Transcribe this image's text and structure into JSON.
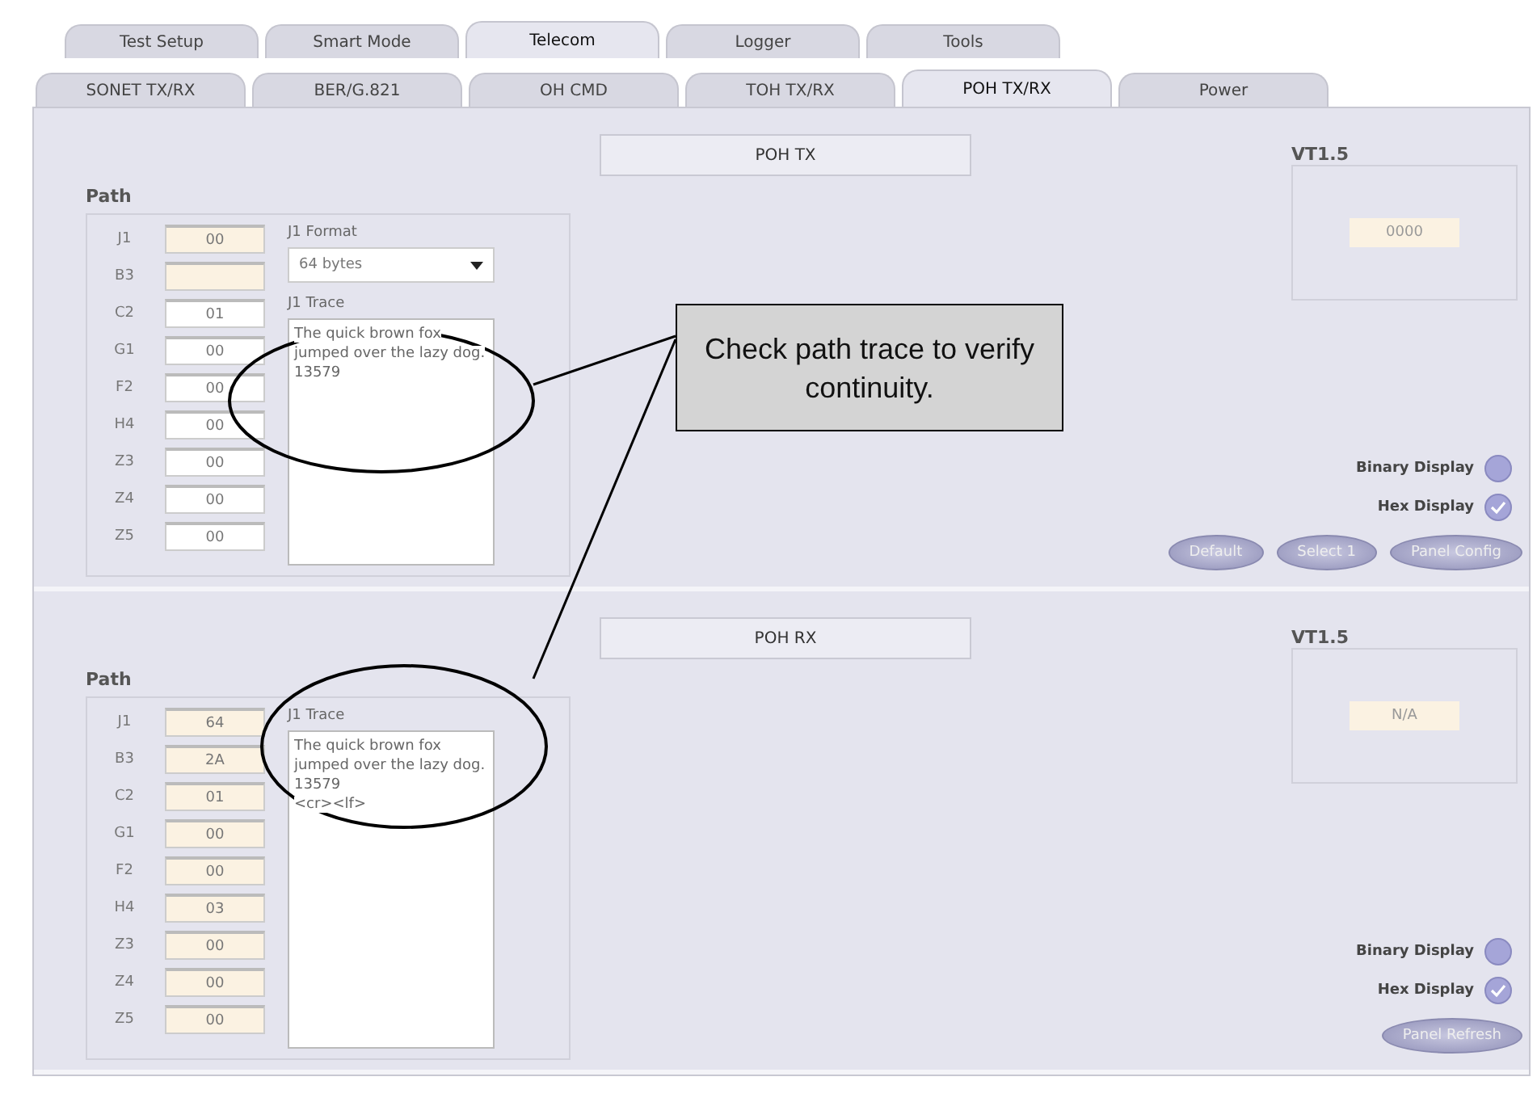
{
  "tabs_top": [
    {
      "label": "Test Setup",
      "selected": false
    },
    {
      "label": "Smart Mode",
      "selected": false
    },
    {
      "label": "Telecom",
      "selected": true
    },
    {
      "label": "Logger",
      "selected": false
    },
    {
      "label": "Tools",
      "selected": false
    }
  ],
  "tabs_sub": [
    {
      "label": "SONET TX/RX",
      "selected": false
    },
    {
      "label": "BER/G.821",
      "selected": false
    },
    {
      "label": "OH CMD",
      "selected": false
    },
    {
      "label": "TOH TX/RX",
      "selected": false
    },
    {
      "label": "POH TX/RX",
      "selected": true
    },
    {
      "label": "Power",
      "selected": false
    }
  ],
  "sections": [
    {
      "header": "POH TX",
      "path_label": "Path",
      "fields": [
        {
          "label": "J1",
          "value": "00",
          "disabled": true
        },
        {
          "label": "B3",
          "disabled": true
        },
        {
          "label": "C2",
          "value": "01",
          "disabled": false
        },
        {
          "label": "G1",
          "value": "00",
          "disabled": false
        },
        {
          "label": "F2",
          "value": "00",
          "disabled": false
        },
        {
          "label": "H4",
          "value": "00",
          "disabled": false
        },
        {
          "label": "Z3",
          "value": "00",
          "disabled": false
        },
        {
          "label": "Z4",
          "value": "00",
          "disabled": false
        },
        {
          "label": "Z5",
          "value": "00",
          "disabled": false
        }
      ],
      "format": {
        "label": "J1 Format",
        "value": "64 bytes"
      },
      "trace_label": "J1 Trace",
      "trace": [
        "The quick brown fox jumped over the lazy dog. 13579"
      ],
      "vt": {
        "title": "VT1.5",
        "value": "0000"
      },
      "radios": [
        {
          "label": "Binary Display",
          "selected": false
        },
        {
          "label": "Hex Display",
          "selected": true
        }
      ],
      "buttons": [
        "Default",
        "Select 1",
        "Panel Config"
      ]
    },
    {
      "header": "POH RX",
      "path_label": "Path",
      "fields": [
        {
          "label": "J1",
          "value": "64",
          "disabled": true
        },
        {
          "label": "B3",
          "value": "2A",
          "disabled": true
        },
        {
          "label": "C2",
          "value": "01",
          "disabled": true
        },
        {
          "label": "G1",
          "value": "00",
          "disabled": true
        },
        {
          "label": "F2",
          "value": "00",
          "disabled": true
        },
        {
          "label": "H4",
          "value": "03",
          "disabled": true
        },
        {
          "label": "Z3",
          "value": "00",
          "disabled": true
        },
        {
          "label": "Z4",
          "value": "00",
          "disabled": true
        },
        {
          "label": "Z5",
          "value": "00",
          "disabled": true
        }
      ],
      "trace_label": "J1 Trace",
      "trace": [
        "The quick brown fox jumped over the lazy dog. 13579",
        "<cr><lf>"
      ],
      "vt": {
        "title": "VT1.5",
        "value": "N/A"
      },
      "radios": [
        {
          "label": "Binary Display",
          "selected": false
        },
        {
          "label": "Hex Display",
          "selected": true
        }
      ],
      "buttons": [
        "Panel Refresh"
      ]
    }
  ],
  "callout": {
    "text": "Check path trace to verify continuity."
  }
}
